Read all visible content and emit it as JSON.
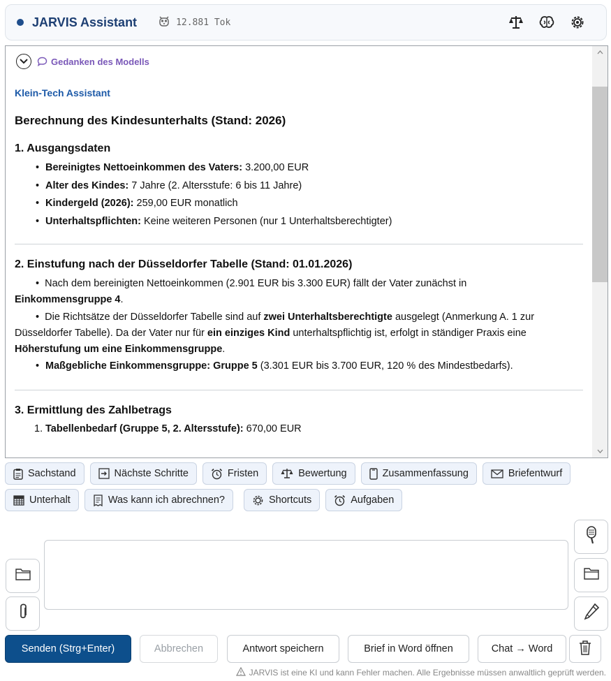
{
  "header": {
    "title": "JARVIS Assistant",
    "token_icon": "owl-icon",
    "token_count": "12.881 Tok",
    "icons": [
      "scales-icon",
      "brain-icon",
      "gear-icon"
    ]
  },
  "chat": {
    "thoughts_label": "Gedanken des Modells",
    "assistant_name": "Klein-Tech Assistant",
    "title": "Berechnung des Kindesunterhalts (Stand: 2026)",
    "section1": {
      "heading": "1. Ausgangsdaten",
      "items": [
        {
          "label": "Bereinigtes Nettoeinkommen des Vaters:",
          "value": "3.200,00 EUR"
        },
        {
          "label": "Alter des Kindes:",
          "value": "7 Jahre (2. Altersstufe: 6 bis 11 Jahre)"
        },
        {
          "label": "Kindergeld (2026):",
          "value": "259,00 EUR monatlich"
        },
        {
          "label": "Unterhaltspflichten:",
          "value": "Keine weiteren Personen (nur 1 Unterhaltsberechtigter)"
        }
      ]
    },
    "section2": {
      "heading": "2. Einstufung nach der Düsseldorfer Tabelle (Stand: 01.01.2026)",
      "p1_a": "Nach dem bereinigten Nettoeinkommen (2.901 EUR bis 3.300 EUR) fällt der Vater zunächst in",
      "p1_b": "Einkommensgruppe 4",
      "p1_c": ".",
      "p2_a": "Die Richtsätze der Düsseldorfer Tabelle sind auf ",
      "p2_b": "zwei Unterhaltsberechtigte",
      "p2_c": " ausgelegt (Anmerkung A. 1 zur Düsseldorfer Tabelle). Da der Vater nur für ",
      "p2_d": "ein einziges Kind",
      "p2_e": " unterhaltspflichtig ist, erfolgt in ständiger Praxis eine ",
      "p2_f": "Höherstufung um eine Einkommensgruppe",
      "p2_g": ".",
      "p3_label": "Maßgebliche Einkommensgruppe: Gruppe 5",
      "p3_value": " (3.301 EUR bis 3.700 EUR, 120 % des Mindestbedarfs)."
    },
    "section3": {
      "heading": "3. Ermittlung des Zahlbetrags",
      "items": [
        {
          "num": "1.",
          "label": "Tabellenbedarf (Gruppe 5, 2. Altersstufe):",
          "value": "670,00 EUR"
        }
      ]
    }
  },
  "quick_buttons_row1": [
    {
      "label": "Sachstand",
      "icon": "clipboard-icon"
    },
    {
      "label": "Nächste Schritte",
      "icon": "arrow-right-box-icon"
    },
    {
      "label": "Fristen",
      "icon": "alarm-clock-icon"
    },
    {
      "label": "Bewertung",
      "icon": "scales-icon"
    },
    {
      "label": "Zusammenfassung",
      "icon": "tablet-icon"
    },
    {
      "label": "Briefentwurf",
      "icon": "envelope-icon"
    }
  ],
  "quick_buttons_row2": [
    {
      "label": "Unterhalt",
      "icon": "calculator-icon"
    },
    {
      "label": "Was kann ich abrechnen?",
      "icon": "receipt-icon"
    },
    {
      "label": "Shortcuts",
      "icon": "gear-icon"
    },
    {
      "label": "Aufgaben",
      "icon": "alarm-clock-icon"
    }
  ],
  "input": {
    "placeholder": "",
    "left_icons": [
      "folder-icon",
      "paperclip-icon"
    ],
    "right_icons": [
      "microphone-icon",
      "folder-icon",
      "pen-icon"
    ]
  },
  "actions": {
    "send": "Senden (Strg+Enter)",
    "cancel": "Abbrechen",
    "save": "Antwort speichern",
    "word_letter": "Brief in Word öffnen",
    "chat_word": "Chat → Word",
    "trash_icon": "trash-icon"
  },
  "disclaimer": "JARVIS ist eine KI und kann Fehler machen. Alle Ergebnisse müssen anwaltlich geprüft werden.",
  "colors": {
    "accent": "#0d4f8c",
    "title": "#1d3f73",
    "assistant_name": "#1d5aa8",
    "thoughts": "#7a58b8",
    "quick_button_bg": "#eef3fb"
  }
}
